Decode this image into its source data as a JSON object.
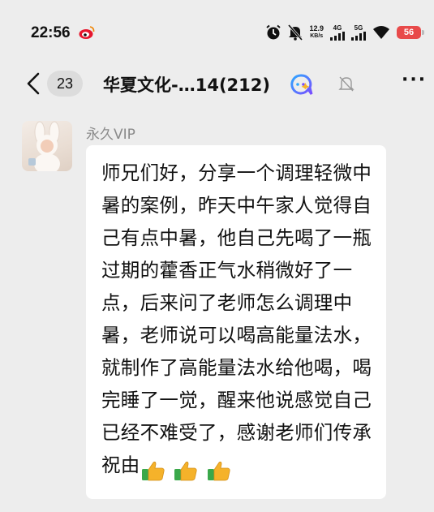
{
  "status_bar": {
    "time": "22:56",
    "net_speed_value": "12.9",
    "net_speed_unit": "KB/s",
    "network_4g": "4G",
    "network_5g": "5G",
    "battery": "56"
  },
  "header": {
    "unread_count": "23",
    "title": "华夏文化-…14(212)"
  },
  "message": {
    "sender": "永久VIP",
    "text": "师兄们好，分享一个调理轻微中暑的案例，昨天中午家人觉得自己有点中暑，他自己先喝了一瓶过期的藿香正气水稍微好了一点，后来问了老师怎么调理中暑，老师说可以喝高能量法水，就制作了高能量法水给他喝，喝完睡了一觉，醒来他说感觉自己已经不难受了，感谢老师们传承祝由",
    "emoji": [
      "thumbs-up",
      "thumbs-up",
      "thumbs-up"
    ]
  },
  "colors": {
    "background": "#ededed",
    "bubble": "#ffffff",
    "battery": "#e84a4a",
    "thumb_yellow": "#f5b22a",
    "thumb_sleeve": "#3aa84a"
  }
}
